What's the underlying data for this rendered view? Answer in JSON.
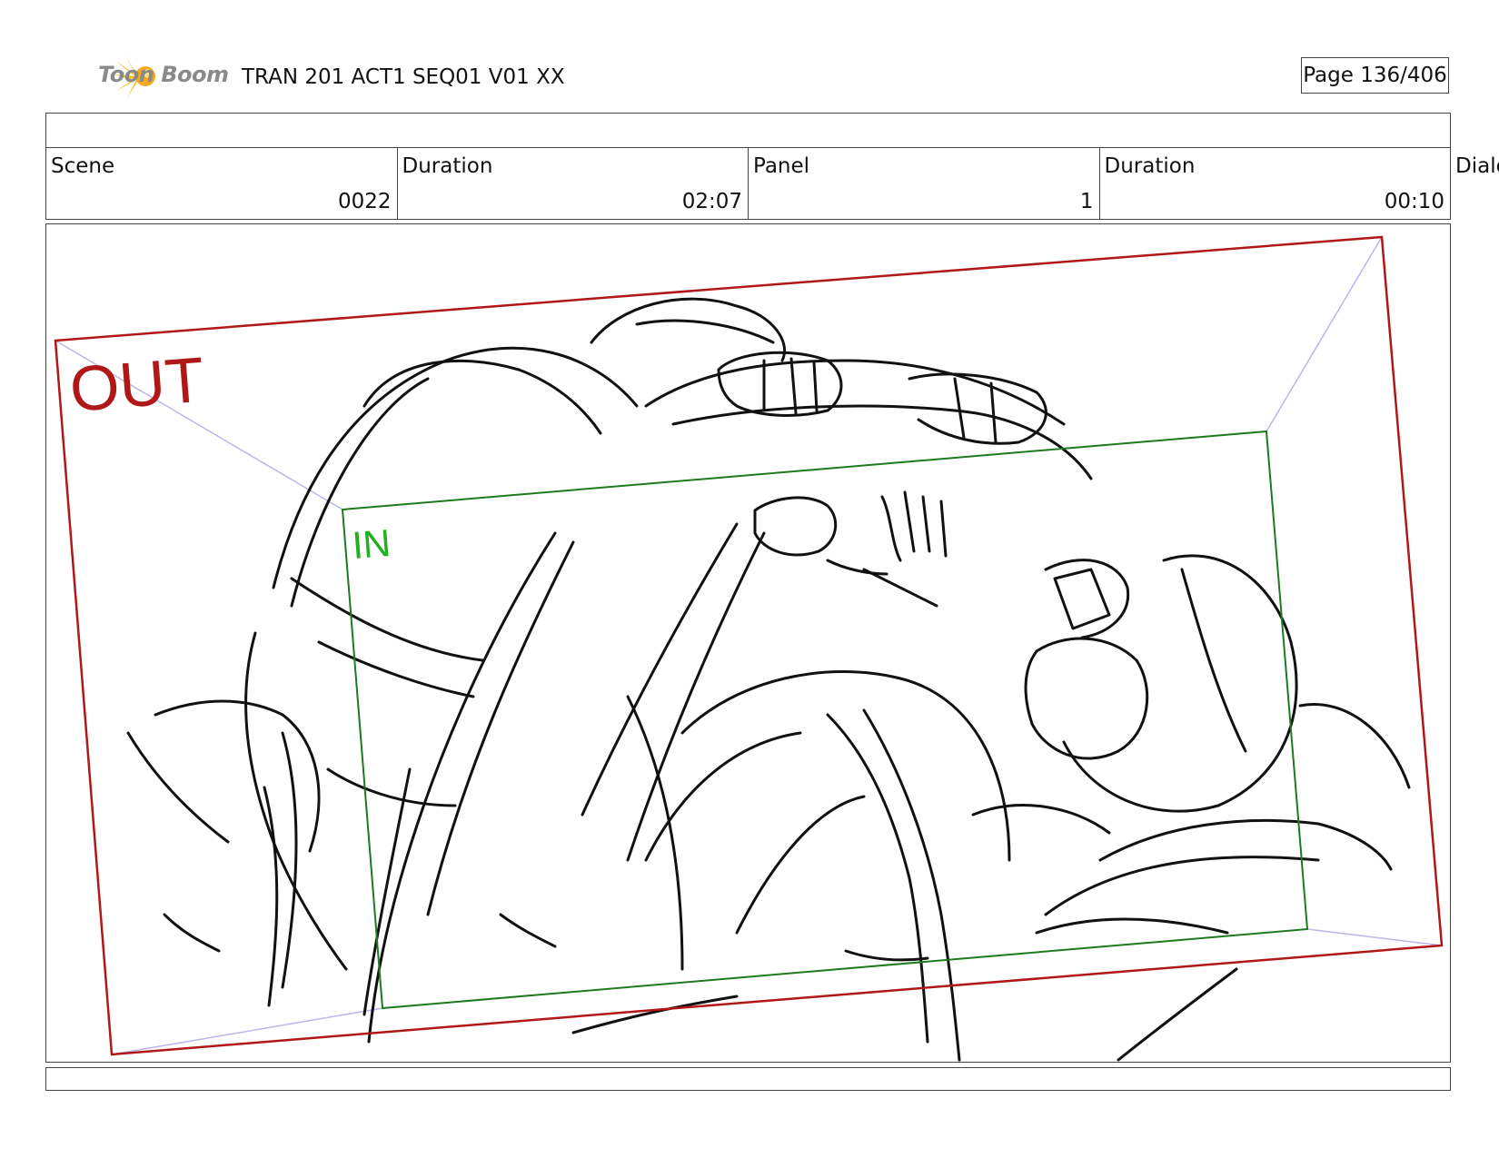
{
  "header": {
    "logo_text": "Toon Boom",
    "title": "TRAN 201 ACT1 SEQ01 V01 XX",
    "page": "Page 136/406"
  },
  "info": {
    "scene_label": "Scene",
    "scene_value": "0022",
    "scene_duration_label": "Duration",
    "scene_duration_value": "02:07",
    "panel_label": "Panel",
    "panel_value": "1",
    "panel_duration_label": "Duration",
    "panel_duration_value": "00:10",
    "dialog_label": "Dialo"
  },
  "frame": {
    "out_label": "OUT",
    "in_label": "IN",
    "out_color": "#b01818",
    "in_color": "#1f7a1f",
    "in_text_color": "#22b022",
    "perspective_color": "#b8b8e8"
  }
}
